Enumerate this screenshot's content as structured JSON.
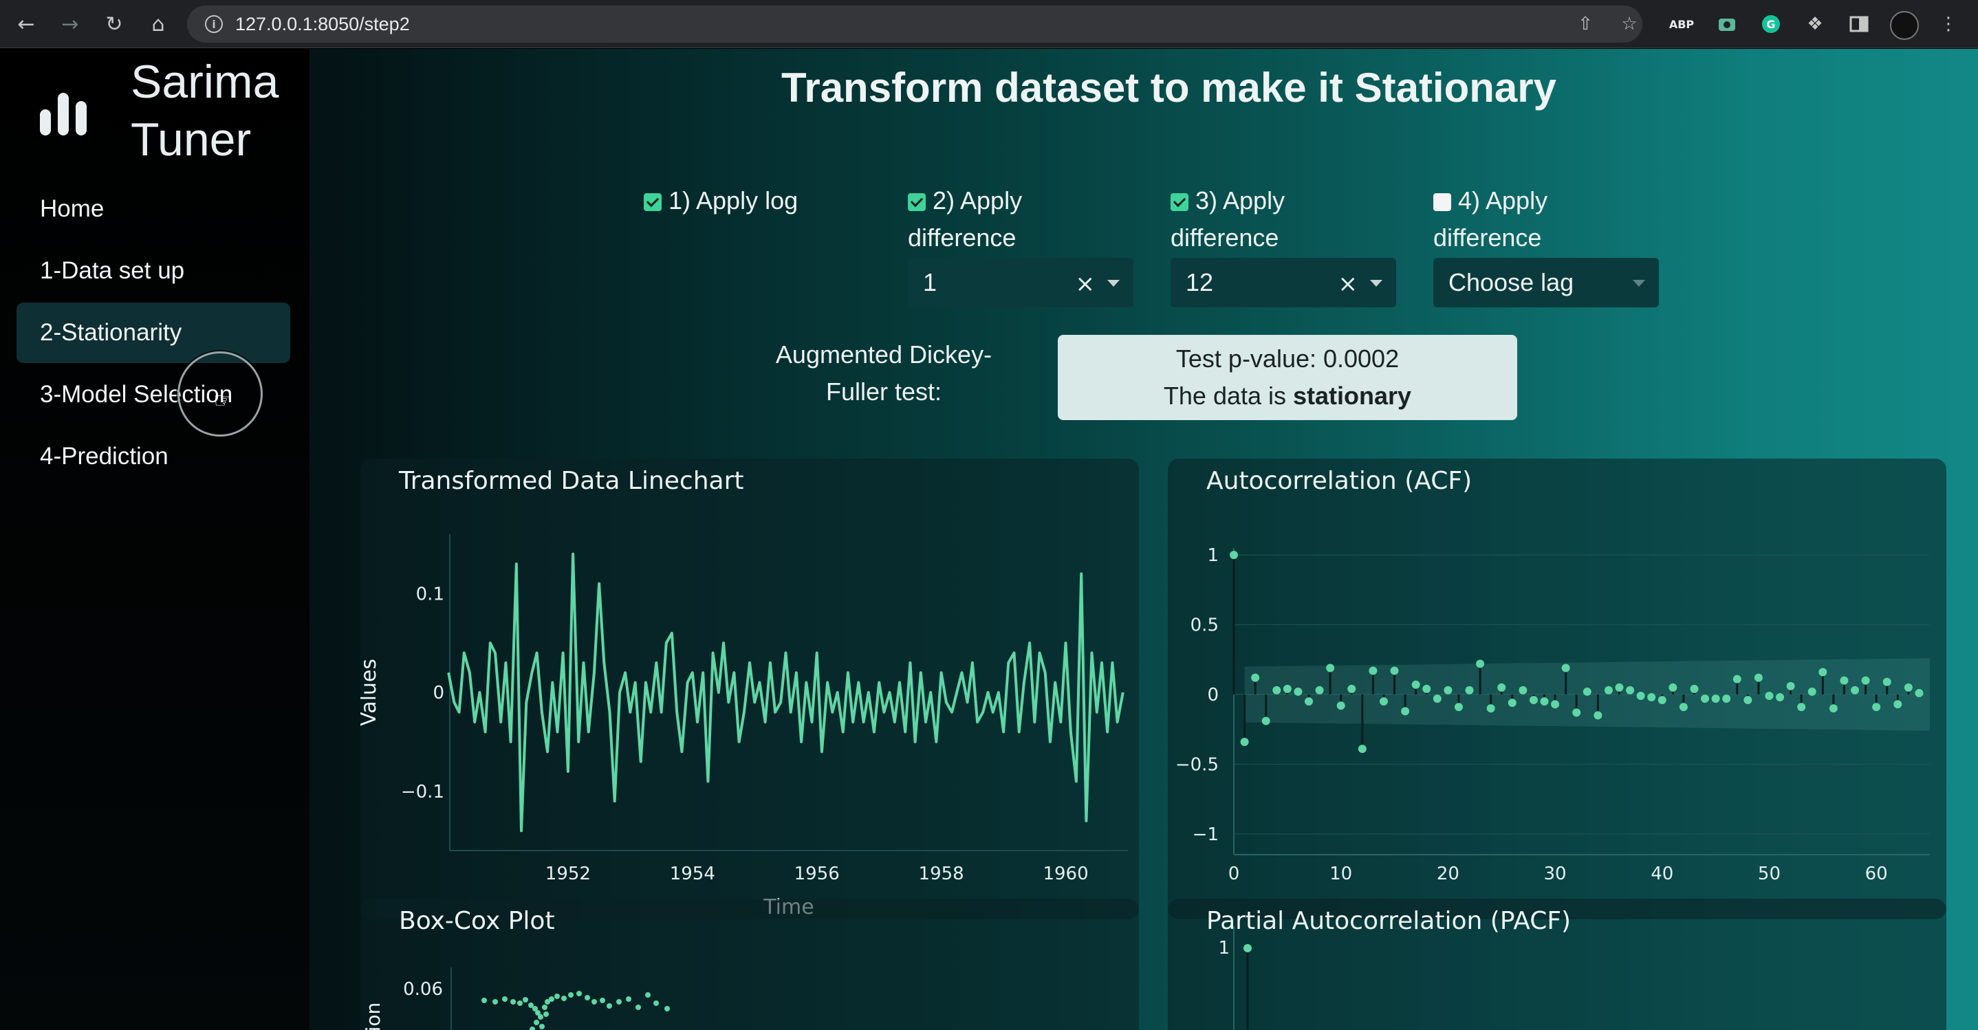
{
  "browser": {
    "url": "127.0.0.1:8050/step2",
    "extension_label": "ABP"
  },
  "sidebar": {
    "brand_line1": "Sarima",
    "brand_line2": "Tuner",
    "items": [
      {
        "label": "Home"
      },
      {
        "label": "1-Data set up"
      },
      {
        "label": "2-Stationarity",
        "active": true
      },
      {
        "label": "3-Model Selection"
      },
      {
        "label": "4-Prediction"
      }
    ]
  },
  "main": {
    "title": "Transform dataset to make it Stationary",
    "options": [
      {
        "checked": true,
        "line1": "1) Apply log",
        "line2": ""
      },
      {
        "checked": true,
        "line1": "2) Apply",
        "line2": "difference",
        "dropdown_value": "1"
      },
      {
        "checked": true,
        "line1": "3) Apply",
        "line2": "difference",
        "dropdown_value": "12"
      },
      {
        "checked": false,
        "line1": "4) Apply",
        "line2": "difference",
        "dropdown_placeholder": "Choose lag"
      }
    ],
    "adf_label_line1": "Augmented Dickey-",
    "adf_label_line2": "Fuller test:",
    "pvalue_text": "Test p-value: 0.0002",
    "result_prefix": "The data is ",
    "result_value": "stationary"
  },
  "colors": {
    "accent": "#5fd6a4",
    "active_nav": "#0e2f33",
    "result_box": "#d9e9e8"
  },
  "chart_data": [
    {
      "type": "line",
      "title": "Transformed Data Linechart",
      "xlabel": "Time",
      "ylabel": "Values",
      "xlim": [
        1950.1,
        1961.0
      ],
      "ylim": [
        -0.16,
        0.16
      ],
      "xticks": [
        "1952",
        "1954",
        "1956",
        "1958",
        "1960"
      ],
      "yticks": [
        "0.1",
        "0",
        "−0.1"
      ],
      "series": [
        {
          "x": [
            1950.08,
            1950.17,
            1950.25,
            1950.33,
            1950.42,
            1950.5,
            1950.58,
            1950.67,
            1950.75,
            1950.83,
            1950.92,
            1951.0,
            1951.08,
            1951.17,
            1951.25,
            1951.33,
            1951.42,
            1951.5,
            1951.58,
            1951.67,
            1951.75,
            1951.83,
            1951.92,
            1952.0,
            1952.08,
            1952.17,
            1952.25,
            1952.33,
            1952.42,
            1952.5,
            1952.58,
            1952.67,
            1952.75,
            1952.83,
            1952.92,
            1953.0,
            1953.08,
            1953.17,
            1953.25,
            1953.33,
            1953.42,
            1953.5,
            1953.58,
            1953.67,
            1953.75,
            1953.83,
            1953.92,
            1954.0,
            1954.08,
            1954.17,
            1954.25,
            1954.33,
            1954.42,
            1954.5,
            1954.58,
            1954.67,
            1954.75,
            1954.83,
            1954.92,
            1955.0,
            1955.08,
            1955.17,
            1955.25,
            1955.33,
            1955.42,
            1955.5,
            1955.58,
            1955.67,
            1955.75,
            1955.83,
            1955.92,
            1956.0,
            1956.08,
            1956.17,
            1956.25,
            1956.33,
            1956.42,
            1956.5,
            1956.58,
            1956.67,
            1956.75,
            1956.83,
            1956.92,
            1957.0,
            1957.08,
            1957.17,
            1957.25,
            1957.33,
            1957.42,
            1957.5,
            1957.58,
            1957.67,
            1957.75,
            1957.83,
            1957.92,
            1958.0,
            1958.08,
            1958.17,
            1958.25,
            1958.33,
            1958.42,
            1958.5,
            1958.58,
            1958.67,
            1958.75,
            1958.83,
            1958.92,
            1959.0,
            1959.08,
            1959.17,
            1959.25,
            1959.33,
            1959.42,
            1959.5,
            1959.58,
            1959.67,
            1959.75,
            1959.83,
            1959.92,
            1960.0,
            1960.08,
            1960.17,
            1960.25,
            1960.33,
            1960.42,
            1960.5,
            1960.58,
            1960.67,
            1960.75,
            1960.83,
            1960.92
          ],
          "values": [
            0.02,
            -0.01,
            -0.02,
            0.04,
            0.02,
            -0.03,
            0.0,
            -0.04,
            0.05,
            0.04,
            -0.03,
            0.03,
            -0.05,
            0.13,
            -0.14,
            -0.01,
            0.02,
            0.04,
            -0.02,
            -0.06,
            0.01,
            -0.04,
            0.04,
            -0.08,
            0.14,
            -0.05,
            0.03,
            -0.04,
            0.02,
            0.11,
            0.03,
            -0.02,
            -0.11,
            0.0,
            0.02,
            -0.02,
            0.01,
            -0.07,
            0.01,
            -0.02,
            0.03,
            -0.02,
            0.05,
            0.06,
            -0.02,
            -0.06,
            0.01,
            0.02,
            -0.03,
            0.02,
            -0.09,
            0.04,
            0.0,
            0.05,
            -0.01,
            0.02,
            -0.05,
            -0.02,
            0.03,
            -0.01,
            0.01,
            -0.03,
            0.03,
            -0.02,
            -0.01,
            0.04,
            -0.02,
            0.02,
            -0.05,
            0.01,
            -0.03,
            0.04,
            -0.06,
            0.01,
            -0.02,
            0.0,
            -0.04,
            0.02,
            -0.03,
            0.01,
            -0.03,
            0.0,
            -0.04,
            0.01,
            -0.02,
            0.0,
            -0.03,
            0.01,
            -0.04,
            0.03,
            -0.05,
            0.02,
            -0.03,
            0.0,
            -0.05,
            0.02,
            -0.01,
            -0.02,
            0.0,
            0.02,
            -0.01,
            0.03,
            -0.03,
            -0.02,
            0.0,
            -0.02,
            0.0,
            -0.04,
            0.03,
            0.04,
            -0.04,
            0.01,
            0.05,
            -0.03,
            0.04,
            0.02,
            -0.05,
            0.01,
            -0.03,
            0.05,
            -0.04,
            -0.09,
            0.12,
            -0.13,
            0.04,
            -0.02,
            0.03,
            -0.04,
            0.03,
            -0.03,
            0.0
          ]
        }
      ]
    },
    {
      "type": "scatter",
      "title": "Autocorrelation (ACF)",
      "xlim": [
        0,
        65
      ],
      "ylim": [
        -1.05,
        1.05
      ],
      "xticks": [
        "0",
        "10",
        "20",
        "30",
        "40",
        "50",
        "60"
      ],
      "yticks": [
        "1",
        "0.5",
        "0",
        "−0.5",
        "−1"
      ],
      "series": [
        {
          "values": [
            1,
            -0.34,
            0.12,
            -0.19,
            0.03,
            0.04,
            0.02,
            -0.05,
            0.03,
            0.19,
            -0.08,
            0.04,
            -0.39,
            0.17,
            -0.05,
            0.17,
            -0.12,
            0.07,
            0.04,
            -0.03,
            0.03,
            -0.09,
            0.03,
            0.22,
            -0.1,
            0.05,
            -0.06,
            0.03,
            -0.04,
            -0.05,
            -0.07,
            0.19,
            -0.13,
            0.02,
            -0.15,
            0.03,
            0.05,
            0.03,
            -0.01,
            -0.02,
            -0.04,
            0.05,
            -0.09,
            0.04,
            -0.03,
            -0.03,
            -0.03,
            0.11,
            -0.04,
            0.12,
            -0.01,
            -0.02,
            0.06,
            -0.09,
            0.02,
            0.16,
            -0.1,
            0.1,
            0.03,
            0.1,
            -0.09,
            0.09,
            -0.07,
            0.05,
            0.01
          ]
        }
      ]
    },
    {
      "type": "scatter",
      "title": "Box-Cox Plot",
      "ylabel": "iation",
      "yticks": [
        "0.06"
      ]
    },
    {
      "type": "scatter",
      "title": "Partial Autocorrelation (PACF)",
      "yticks": [
        "1"
      ]
    }
  ]
}
